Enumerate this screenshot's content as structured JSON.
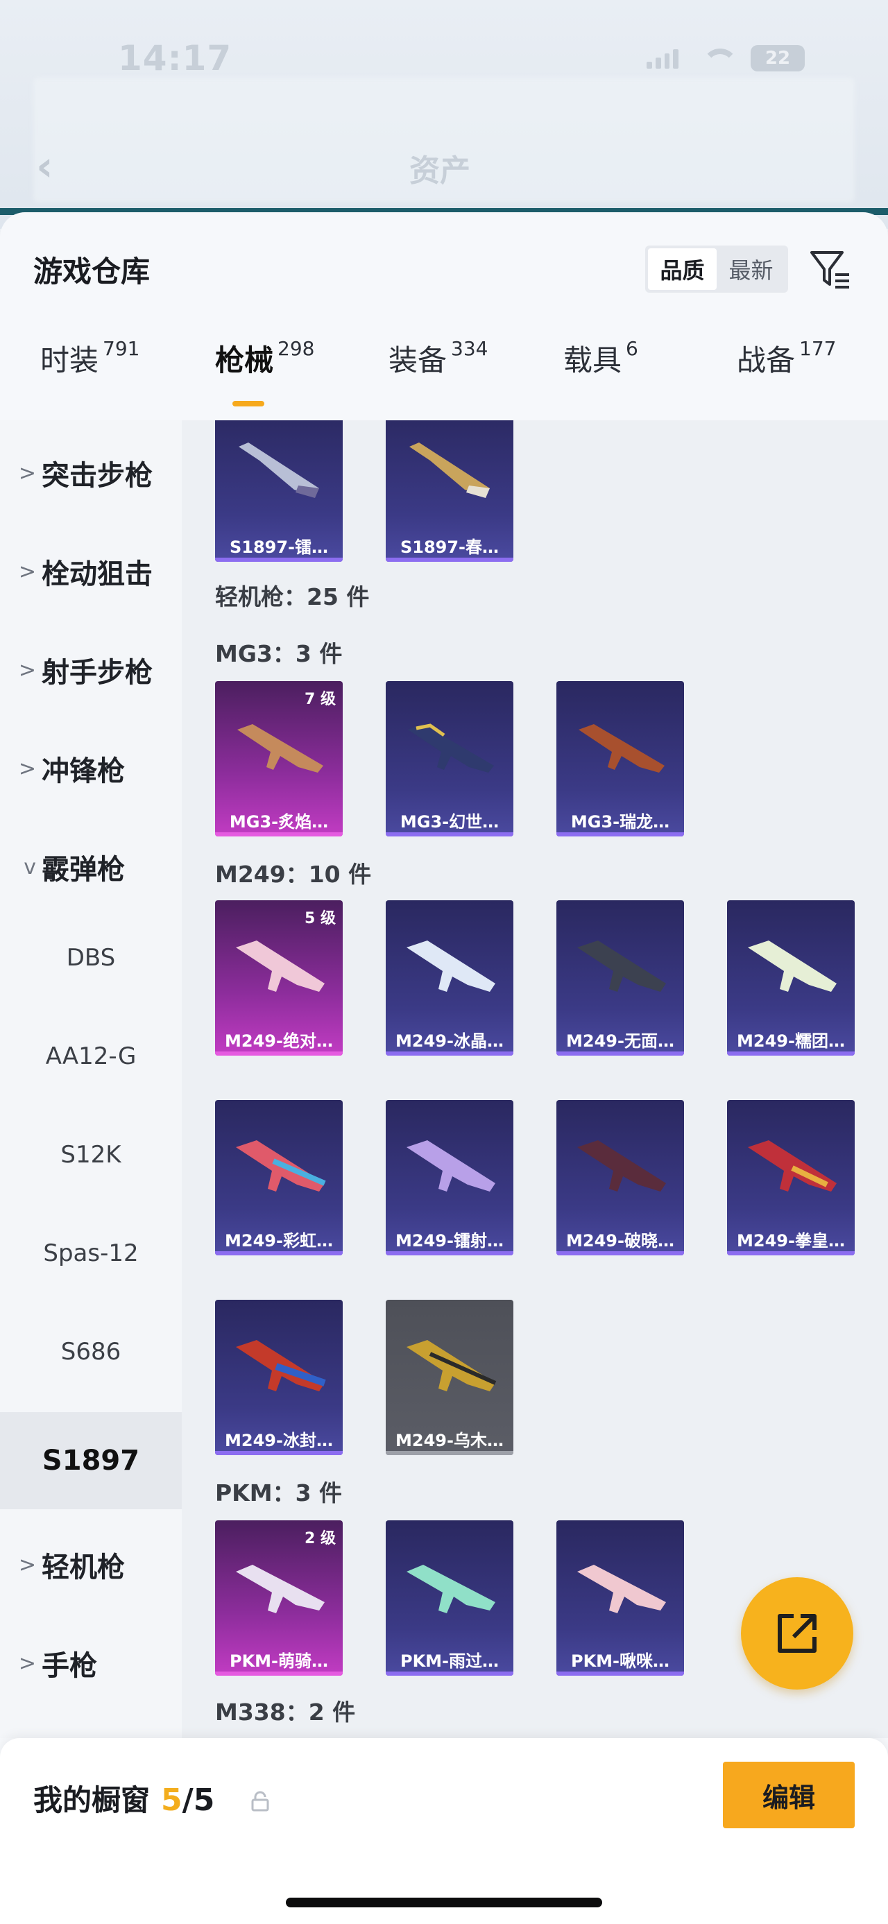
{
  "status": {
    "time": "14:17",
    "battery": "22"
  },
  "background": {
    "heading": "资产"
  },
  "header": {
    "title": "游戏仓库",
    "sort_options": [
      "品质",
      "最新"
    ],
    "sort_active": 0
  },
  "tabs": [
    {
      "label": "时装",
      "count": "791"
    },
    {
      "label": "枪械",
      "count": "298",
      "active": true
    },
    {
      "label": "装备",
      "count": "334"
    },
    {
      "label": "载具",
      "count": "6"
    },
    {
      "label": "战备",
      "count": "177"
    }
  ],
  "sidebar": {
    "categories": [
      {
        "label": "突击步枪",
        "chevron": ">"
      },
      {
        "label": "栓动狙击",
        "chevron": ">"
      },
      {
        "label": "射手步枪",
        "chevron": ">"
      },
      {
        "label": "冲锋枪",
        "chevron": ">"
      },
      {
        "label": "霰弹枪",
        "chevron": "v"
      }
    ],
    "subitems": [
      "DBS",
      "AA12-G",
      "S12K",
      "Spas-12",
      "S686",
      "S1897"
    ],
    "active_subitem": "S1897",
    "more_categories": [
      {
        "label": "轻机枪",
        "chevron": ">"
      },
      {
        "label": "手枪",
        "chevron": ">"
      }
    ]
  },
  "content": {
    "top_cards": [
      {
        "name": "S1897-镭…",
        "style": "blue"
      },
      {
        "name": "S1897-春…",
        "style": "blue"
      }
    ],
    "section_title": "轻机枪：25 件",
    "groups": {
      "mg3": {
        "title": "MG3：3 件",
        "cards": [
          {
            "name": "MG3-炙焰…",
            "level": "7 级",
            "style": "pink"
          },
          {
            "name": "MG3-幻世…",
            "style": "blue"
          },
          {
            "name": "MG3-瑞龙…",
            "style": "blue"
          }
        ]
      },
      "m249": {
        "title": "M249：10 件",
        "cards": [
          {
            "name": "M249-绝对…",
            "level": "5 级",
            "style": "pink"
          },
          {
            "name": "M249-冰晶…",
            "style": "blue"
          },
          {
            "name": "M249-无面…",
            "style": "blue"
          },
          {
            "name": "M249-糯团…",
            "style": "blue"
          },
          {
            "name": "M249-彩虹…",
            "style": "blue"
          },
          {
            "name": "M249-镭射…",
            "style": "blue"
          },
          {
            "name": "M249-破晓…",
            "style": "blue"
          },
          {
            "name": "M249-拳皇…",
            "style": "blue"
          },
          {
            "name": "M249-冰封…",
            "style": "blue"
          },
          {
            "name": "M249-乌木…",
            "style": "grey"
          }
        ]
      },
      "pkm": {
        "title": "PKM：3 件",
        "cards": [
          {
            "name": "PKM-萌骑…",
            "level": "2 级",
            "style": "pink"
          },
          {
            "name": "PKM-雨过…",
            "style": "blue"
          },
          {
            "name": "PKM-啾咪…",
            "style": "blue"
          }
        ]
      },
      "m338": {
        "title": "M338：2 件"
      }
    }
  },
  "bottom": {
    "title": "我的橱窗",
    "current": "5",
    "total": "/5",
    "edit_label": "编辑"
  },
  "colors": {
    "accent": "#f7a81e",
    "card_blue": "#3b3a86",
    "card_pink": "#c23cc3"
  },
  "icons": [
    "filter-icon",
    "share-icon",
    "lock-icon",
    "chevron-right-icon",
    "chevron-down-icon",
    "back-icon"
  ]
}
